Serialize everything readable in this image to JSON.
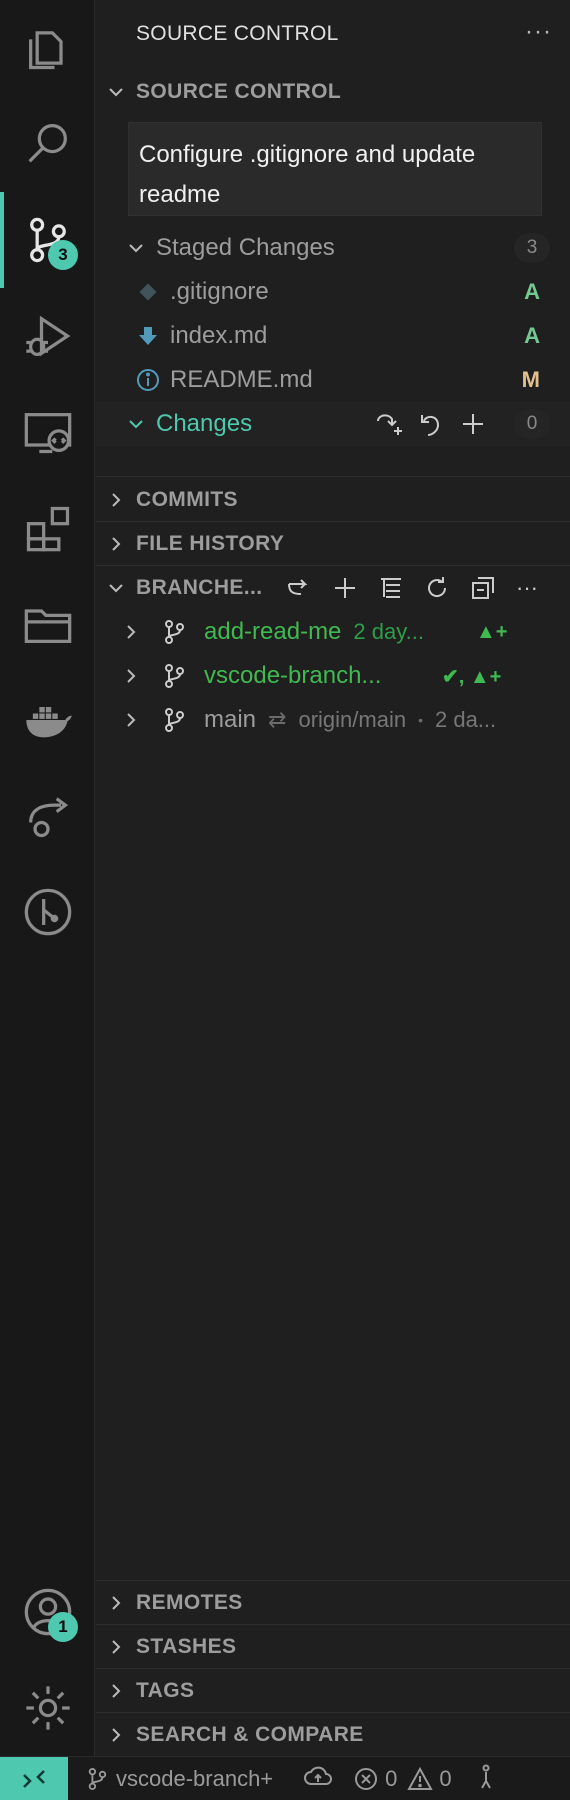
{
  "activity_bar": {
    "scm_badge": "3",
    "accounts_badge": "1"
  },
  "sidebar": {
    "title": "SOURCE CONTROL",
    "more": "···",
    "scm_section": "SOURCE CONTROL",
    "commit_message": "Configure .gitignore and update readme",
    "staged": {
      "label": "Staged Changes",
      "count": "3",
      "files": [
        {
          "name": ".gitignore",
          "status": "A"
        },
        {
          "name": "index.md",
          "status": "A"
        },
        {
          "name": "README.md",
          "status": "M"
        }
      ]
    },
    "changes": {
      "label": "Changes",
      "count": "0"
    },
    "commits_section": "COMMITS",
    "file_history_section": "FILE HISTORY",
    "branches_section": "BRANCHE...",
    "branches": [
      {
        "name": "add-read-me",
        "detail": "2 day...",
        "indicator": "▲+"
      },
      {
        "name": "vscode-branch...",
        "detail": "",
        "indicator": "✔, ▲+"
      },
      {
        "name": "main",
        "arrow": "⇄",
        "upstream": "origin/main",
        "sep": "•",
        "detail": "2 da..."
      }
    ],
    "remotes_section": "REMOTES",
    "stashes_section": "STASHES",
    "tags_section": "TAGS",
    "search_compare_section": "SEARCH & COMPARE"
  },
  "statusbar": {
    "branch": "vscode-branch+",
    "errors": "0",
    "warnings": "0"
  },
  "colors": {
    "accent": "#4ec9b0",
    "added": "#73c991",
    "modified": "#e2c08d",
    "branch_green": "#3fb950"
  }
}
